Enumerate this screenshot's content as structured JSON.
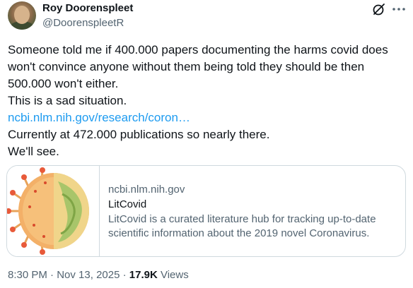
{
  "author": {
    "name": "Roy Doorenspleet",
    "handle": "@DoorenspleetR"
  },
  "icons": {
    "grok": "grok-icon",
    "more": "more-icon"
  },
  "tweet": {
    "line1": "Someone told me if 400.000 papers documenting the harms covid does",
    "line2": "won't convince anyone without them being told they should be then",
    "line3": "500.000 won't either.",
    "line4": "This is a sad situation.",
    "link": "ncbi.nlm.nih.gov/research/coron…",
    "line5": "Currently at 472.000 publications so nearly there.",
    "line6": "We'll see."
  },
  "card": {
    "domain": "ncbi.nlm.nih.gov",
    "title": "LitCovid",
    "description_line1": "LitCovid is a curated literature hub for tracking up-to-date",
    "description_line2": "scientific information about the 2019 novel Coronavirus."
  },
  "footer": {
    "time": "8:30 PM",
    "separator": " · ",
    "date": "Nov 13, 2025",
    "separator2": " · ",
    "views_count": "17.9K",
    "views_label": " Views"
  },
  "colors": {
    "link": "#1d9bf0",
    "secondary_text": "#536471",
    "border": "#cfd9de"
  }
}
